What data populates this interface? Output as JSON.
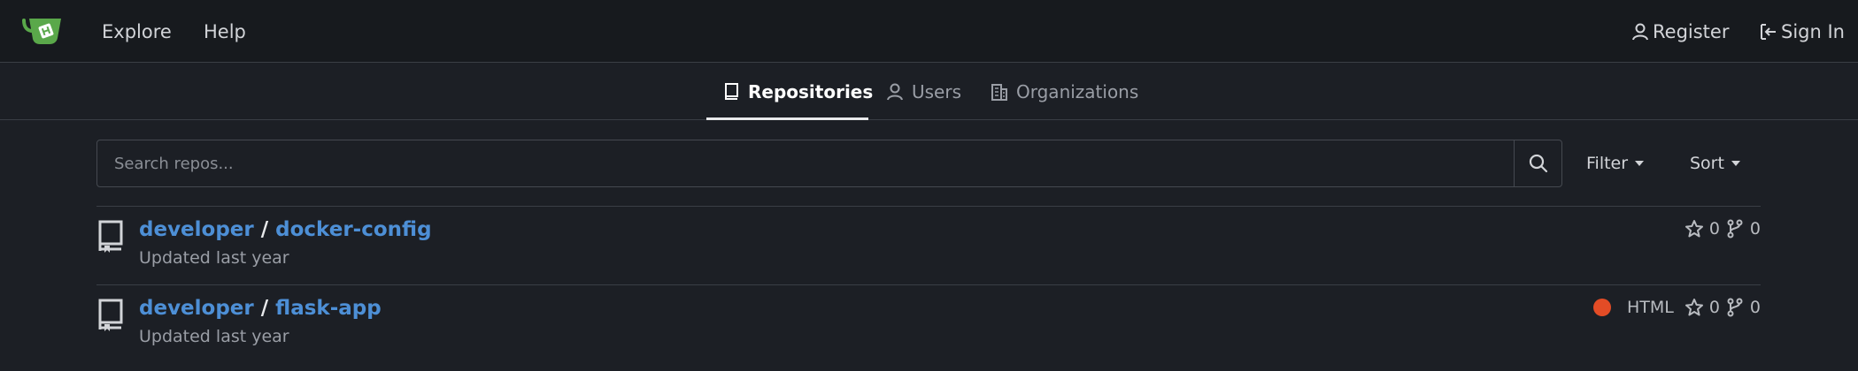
{
  "nav": {
    "explore_label": "Explore",
    "help_label": "Help",
    "register_label": "Register",
    "signin_label": "Sign In"
  },
  "tabs": [
    {
      "label": "Repositories",
      "icon": "repo-icon",
      "active": true
    },
    {
      "label": "Users",
      "icon": "person-icon",
      "active": false
    },
    {
      "label": "Organizations",
      "icon": "organization-icon",
      "active": false
    }
  ],
  "search": {
    "placeholder": "Search repos...",
    "value": ""
  },
  "filters": {
    "filter_label": "Filter",
    "sort_label": "Sort"
  },
  "repos": [
    {
      "owner": "developer",
      "separator": "/",
      "name": "docker-config",
      "updated": "Updated last year",
      "language": "",
      "stars": "0",
      "forks": "0"
    },
    {
      "owner": "developer",
      "separator": "/",
      "name": "flask-app",
      "updated": "Updated last year",
      "language": "HTML",
      "language_color": "#e34c26",
      "stars": "0",
      "forks": "0"
    }
  ],
  "colors": {
    "background": "#1c1f25",
    "nav_background": "#171a1e",
    "link": "#4d8fd6",
    "logo": "#5aa84a"
  }
}
